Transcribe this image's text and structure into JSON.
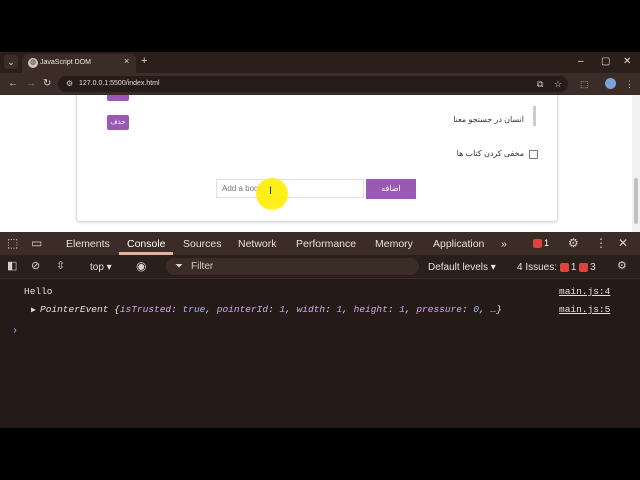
{
  "browser": {
    "tab_title": "JavaScript DOM",
    "url": "127.0.0.1:5500/index.html",
    "tab_close": "×",
    "new_tab": "+",
    "window_controls": [
      "–",
      "▢",
      "✕"
    ]
  },
  "page": {
    "delete_label": "حذف",
    "book_title": "انسان در جستجو معنا",
    "hide_label": "مخفی کردن کتاب ها",
    "add_placeholder": "Add a book...",
    "add_button": "اضافه"
  },
  "devtools": {
    "tabs": [
      "Elements",
      "Console",
      "Sources",
      "Network",
      "Performance",
      "Memory",
      "Application"
    ],
    "more": "»",
    "error_count": "1",
    "context": "top",
    "filter_placeholder": "Filter",
    "levels": "Default levels",
    "issues_label": "4 Issues:",
    "issues_errors": "1",
    "issues_warnings": "3",
    "logs": [
      {
        "text": "Hello",
        "source": "main.js:4"
      },
      {
        "source": "main.js:5"
      }
    ],
    "pointer_event": {
      "name": "PointerEvent",
      "isTrusted_key": "isTrusted",
      "isTrusted_val": "true",
      "pointerId_key": "pointerId",
      "pointerId_val": "1",
      "width_key": "width",
      "width_val": "1",
      "height_key": "height",
      "height_val": "1",
      "pressure_key": "pressure",
      "pressure_val": "0",
      "tail": "…}"
    },
    "prompt": "›"
  }
}
